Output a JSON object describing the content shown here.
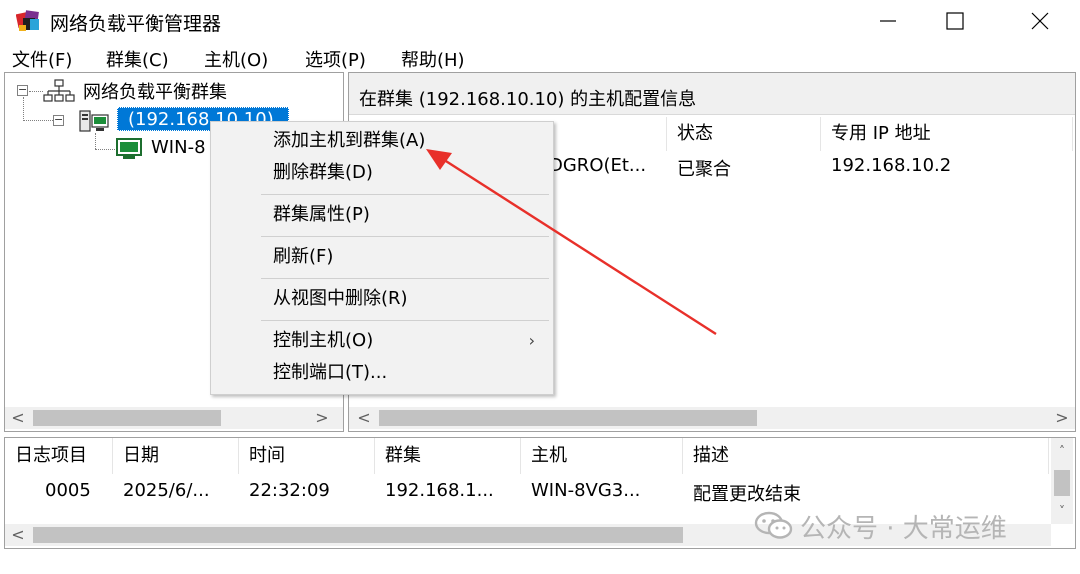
{
  "window": {
    "title": "网络负载平衡管理器"
  },
  "menu": {
    "items": [
      "文件(F)",
      "群集(C)",
      "主机(O)",
      "选项(P)",
      "帮助(H)"
    ]
  },
  "tree": {
    "root_label": "网络负载平衡群集",
    "cluster_label": "(192.168.10.10)",
    "host_label": "WIN-8"
  },
  "right_pane": {
    "header": "在群集 (192.168.10.10) 的主机配置信息",
    "columns": [
      "状态",
      "专用 IP 地址"
    ],
    "row": {
      "partial_interface": "DGRO(Et...",
      "status": "已聚合",
      "ip": "192.168.10.2"
    }
  },
  "context_menu": {
    "items": [
      {
        "label": "添加主机到群集(A)"
      },
      {
        "label": "删除群集(D)"
      },
      {
        "label": "群集属性(P)"
      },
      {
        "label": "刷新(F)"
      },
      {
        "label": "从视图中删除(R)"
      },
      {
        "label": "控制主机(O)",
        "submenu": "›"
      },
      {
        "label": "控制端口(T)..."
      }
    ]
  },
  "log": {
    "columns": [
      "日志项目",
      "日期",
      "时间",
      "群集",
      "主机",
      "描述"
    ],
    "rows": [
      [
        "0005",
        "2025/6/...",
        "22:32:09",
        "192.168.1...",
        "WIN-8VG3...",
        "配置更改结束"
      ]
    ]
  },
  "scroll_arrows": {
    "left": "<",
    "right": ">",
    "up": "˄",
    "down": "˅"
  },
  "watermark": {
    "text": "公众号 · 大常运维"
  },
  "colors": {
    "selection": "#0078d7",
    "annotation_arrow": "#e8302a"
  }
}
